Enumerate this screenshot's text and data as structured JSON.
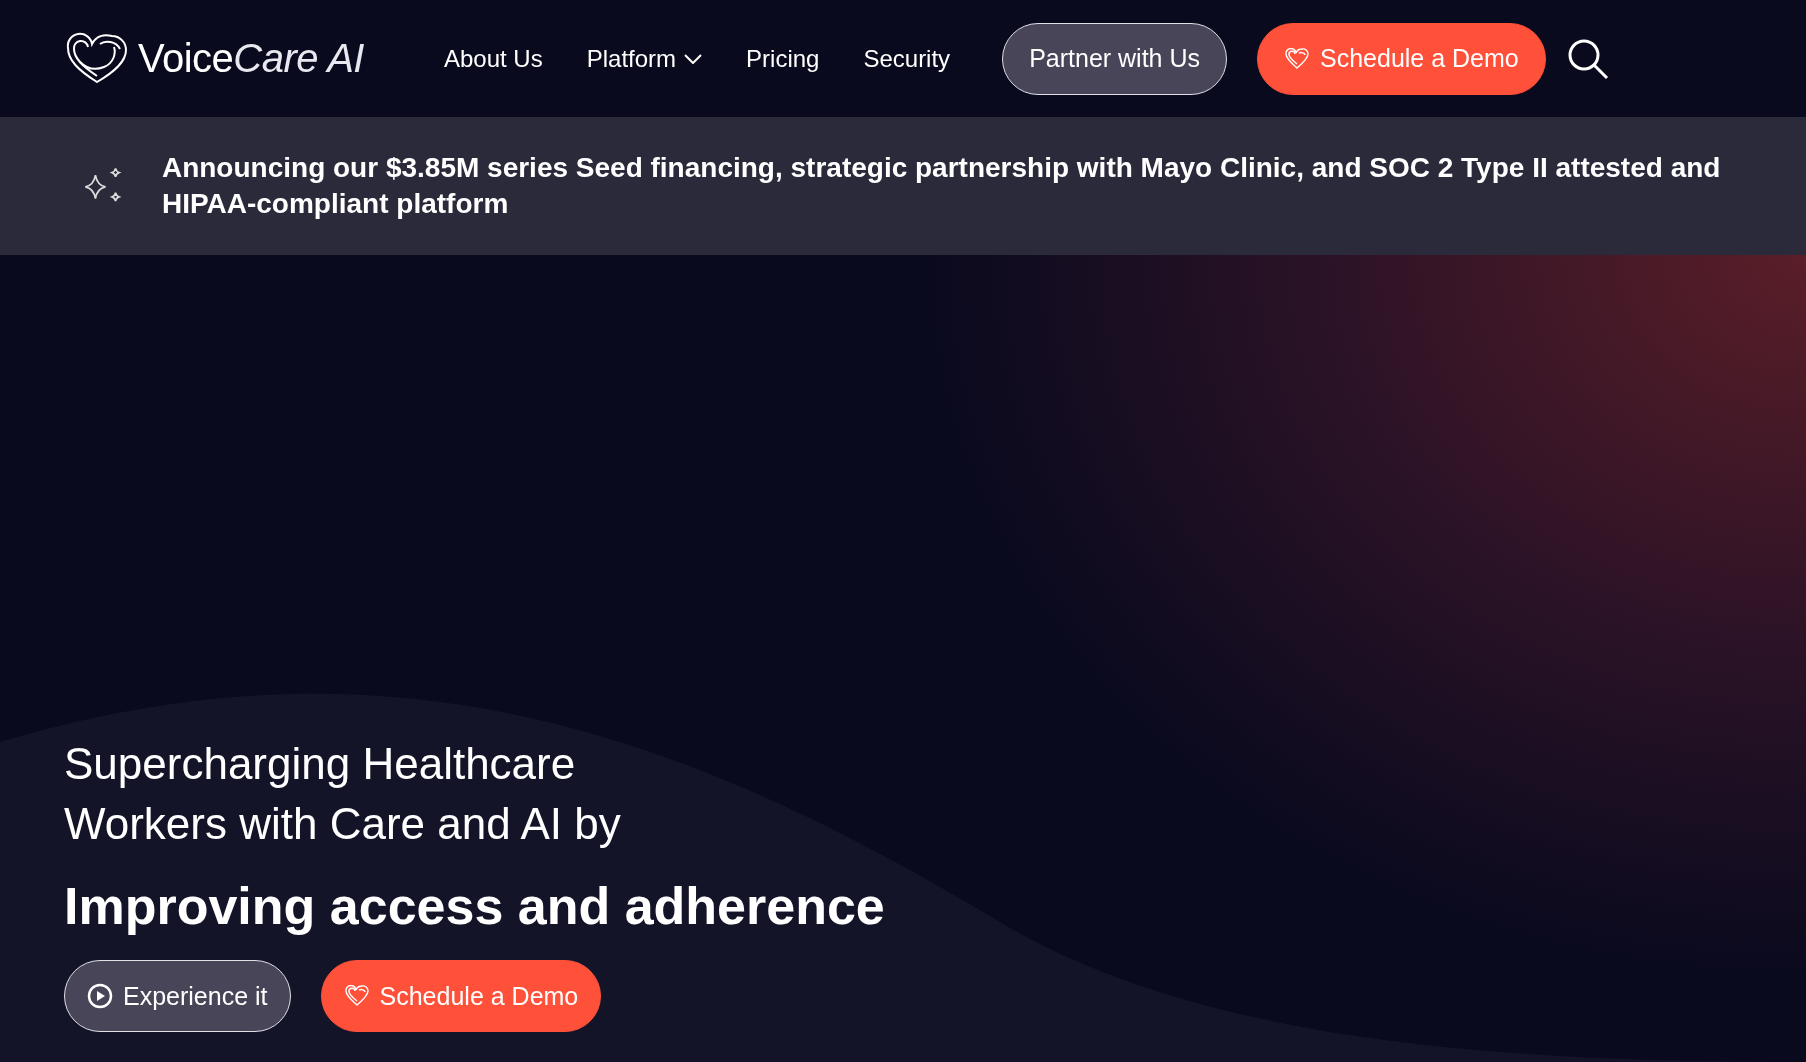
{
  "header": {
    "logo": {
      "primary": "Voice",
      "secondary": "Care AI"
    },
    "nav": [
      {
        "label": "About Us",
        "kind": "link"
      },
      {
        "label": "Platform",
        "kind": "dropdown"
      },
      {
        "label": "Pricing",
        "kind": "link"
      },
      {
        "label": "Security",
        "kind": "link"
      }
    ],
    "buttons": [
      {
        "label": "Partner with Us",
        "kind": "secondary"
      },
      {
        "label": "Schedule a Demo",
        "kind": "primary"
      }
    ]
  },
  "announcement": "Announcing our $3.85M series Seed financing, strategic partnership with Mayo Clinic, and SOC 2 Type II attested and HIPAA-compliant platform",
  "hero": {
    "headline": "Supercharging Healthcare Workers with Care and AI by",
    "subheadline": "Improving access and adherence",
    "buttons": [
      {
        "label": "Experience it",
        "kind": "secondary"
      },
      {
        "label": "Schedule a Demo",
        "kind": "primary"
      }
    ]
  }
}
